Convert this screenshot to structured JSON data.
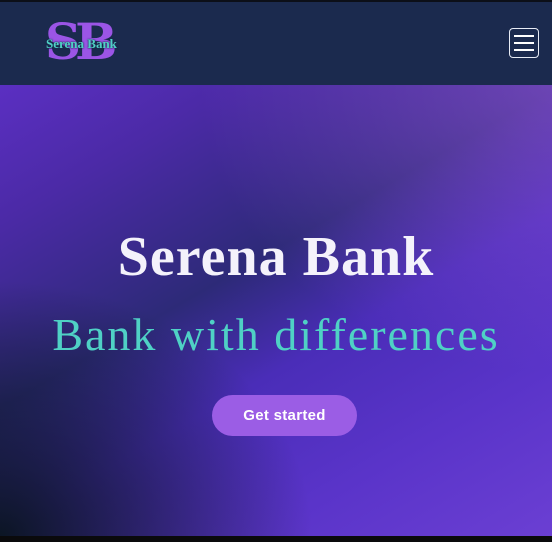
{
  "navbar": {
    "logo": {
      "monogram": "SB",
      "name": "Serena Bank"
    },
    "menu_icon": "hamburger-menu-icon"
  },
  "hero": {
    "title": "Serena Bank",
    "subtitle": "Bank with differences",
    "cta_label": "Get started"
  },
  "colors": {
    "navbar_bg": "#1b2a4e",
    "accent_purple": "#9b5de5",
    "accent_teal": "#4fd1c5",
    "hero_gradient": [
      "#5b2fc2",
      "#2d2a78",
      "#6b3fd3"
    ]
  }
}
